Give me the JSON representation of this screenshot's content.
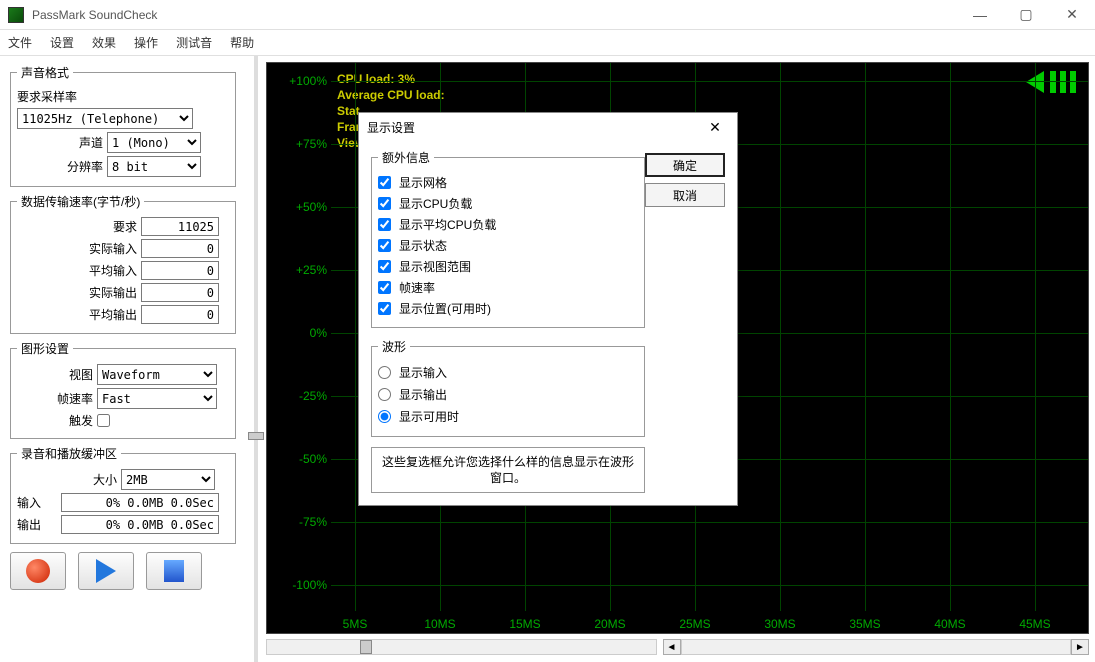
{
  "window": {
    "title": "PassMark SoundCheck"
  },
  "menu": {
    "file": "文件",
    "settings": "设置",
    "effects": "效果",
    "operate": "操作",
    "testtone": "测试音",
    "help": "帮助"
  },
  "soundFormat": {
    "legend": "声音格式",
    "sampleRateLabel": "要求采样率",
    "sampleRateValue": "11025Hz (Telephone)",
    "channelLabel": "声道",
    "channelValue": "1 (Mono)",
    "resolutionLabel": "分辨率",
    "resolutionValue": "8 bit"
  },
  "dataRate": {
    "legend": "数据传输速率(字节/秒)",
    "reqLabel": "要求",
    "reqValue": "11025",
    "actInLabel": "实际输入",
    "actInValue": "0",
    "avgInLabel": "平均输入",
    "avgInValue": "0",
    "actOutLabel": "实际输出",
    "actOutValue": "0",
    "avgOutLabel": "平均输出",
    "avgOutValue": "0"
  },
  "graphSettings": {
    "legend": "图形设置",
    "viewLabel": "视图",
    "viewValue": "Waveform",
    "fpsLabel": "帧速率",
    "fpsValue": "Fast",
    "triggerLabel": "触发"
  },
  "buffer": {
    "legend": "录音和播放缓冲区",
    "sizeLabel": "大小",
    "sizeValue": "2MB",
    "inLabel": "输入",
    "inValue": "0% 0.0MB 0.0Sec",
    "outLabel": "输出",
    "outValue": "0% 0.0MB 0.0Sec"
  },
  "overlay": {
    "cpu": "CPU load: 3%",
    "avgcpu": "Average CPU load: ",
    "stat": "Stat",
    "fram": "Fram",
    "view": "View"
  },
  "ylabels": [
    "+100%",
    "+75%",
    "+50%",
    "+25%",
    "0%",
    "-25%",
    "-50%",
    "-75%",
    "-100%"
  ],
  "xlabels": [
    "5MS",
    "10MS",
    "15MS",
    "20MS",
    "25MS",
    "30MS",
    "35MS",
    "40MS",
    "45MS"
  ],
  "dialog": {
    "title": "显示设置",
    "extraLegend": "额外信息",
    "chkGrid": "显示网格",
    "chkCpu": "显示CPU负载",
    "chkAvgCpu": "显示平均CPU负载",
    "chkStatus": "显示状态",
    "chkView": "显示视图范围",
    "chkFps": "帧速率",
    "chkPos": "显示位置(可用时)",
    "waveLegend": "波形",
    "radioIn": "显示输入",
    "radioOut": "显示输出",
    "radioAvail": "显示可用时",
    "ok": "确定",
    "cancel": "取消",
    "help": "这些复选框允许您选择什么样的信息显示在波形窗口。"
  }
}
